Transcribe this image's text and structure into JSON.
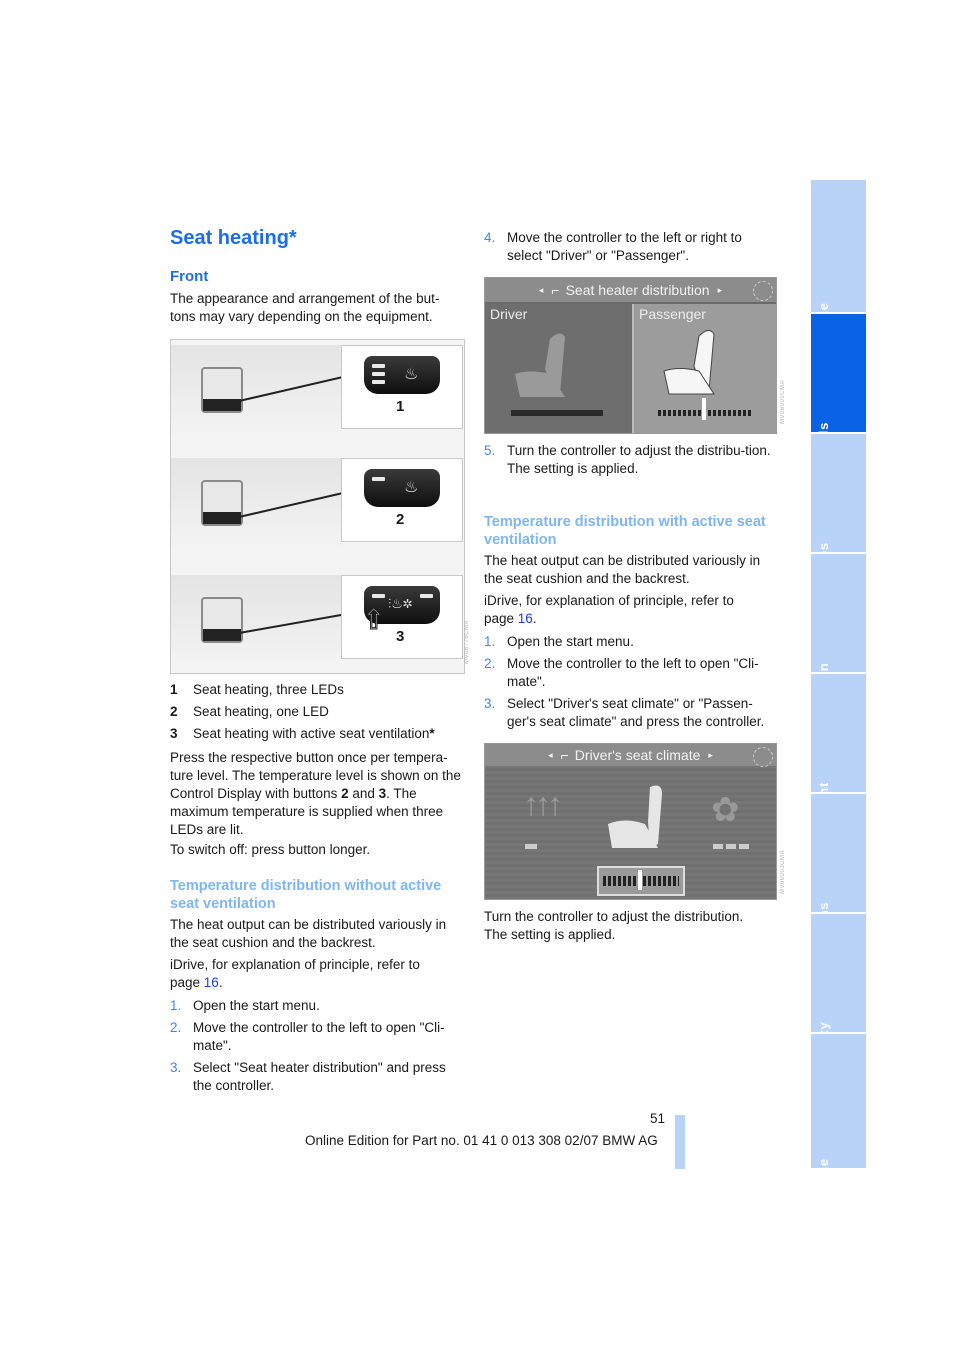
{
  "page": {
    "title": "Seat heating*",
    "page_number": "51",
    "footer": "Online Edition for Part no. 01 41 0 013 308 02/07 BMW AG"
  },
  "left_column": {
    "front_heading": "Front",
    "front_intro": "The appearance and arrangement of the but-tons may vary depending on the equipment.",
    "figure_callouts": [
      "1",
      "2",
      "3"
    ],
    "figure_code": "MV06776CMA",
    "legend": [
      {
        "num": "1",
        "text": "Seat heating, three LEDs"
      },
      {
        "num": "2",
        "text": "Seat heating, one LED"
      },
      {
        "num": "3",
        "text": "Seat heating with active seat ventilation",
        "asterisk": "*"
      }
    ],
    "press_text_1": "Press the respective button once per tempera-ture level. The temperature level is shown on the Control Display with buttons ",
    "press_bold_2": "2",
    "press_text_2": " and ",
    "press_bold_3": "3",
    "press_text_3": ". The maximum temperature is supplied when three LEDs are lit.",
    "switch_off": "To switch off: press button longer.",
    "section_without": {
      "heading": "Temperature distribution without active seat ventilation",
      "intro": "The heat output can be distributed variously in the seat cushion and the backrest.",
      "idrive_prefix": "iDrive, for explanation of principle, refer to page ",
      "idrive_link": "16",
      "idrive_suffix": ".",
      "steps": [
        {
          "num": "1.",
          "text": "Open the start menu."
        },
        {
          "num": "2.",
          "text": "Move the controller to the left to open \"Cli-mate\"."
        },
        {
          "num": "3.",
          "text": "Select \"Seat heater distribution\" and press the controller."
        }
      ]
    }
  },
  "right_column": {
    "step4": {
      "num": "4.",
      "text": "Move the controller to the left or right to select \"Driver\" or \"Passenger\"."
    },
    "screen1": {
      "header": "Seat heater distribution",
      "left_label": "Driver",
      "right_label": "Passenger",
      "selected": "Passenger"
    },
    "step5": {
      "num": "5.",
      "text": "Turn the controller to adjust the distribu-tion.",
      "sub": "The setting is applied."
    },
    "section_with": {
      "heading": "Temperature distribution with active seat ventilation",
      "intro": "The heat output can be distributed variously in the seat cushion and the backrest.",
      "idrive_prefix": "iDrive, for explanation of principle, refer to page ",
      "idrive_link": "16",
      "idrive_suffix": ".",
      "steps": [
        {
          "num": "1.",
          "text": "Open the start menu."
        },
        {
          "num": "2.",
          "text": "Move the controller to the left to open \"Cli-mate\"."
        },
        {
          "num": "3.",
          "text": "Select \"Driver's seat climate\" or \"Passen-ger's seat climate\" and press the controller."
        }
      ]
    },
    "screen2": {
      "header": "Driver's seat climate"
    },
    "closing_1": "Turn the controller to adjust the distribution.",
    "closing_2": "The setting is applied."
  },
  "side_tabs": [
    {
      "label": "At a glance",
      "active": false
    },
    {
      "label": "Controls",
      "active": true
    },
    {
      "label": "Driving tips",
      "active": false
    },
    {
      "label": "Navigation",
      "active": false
    },
    {
      "label": "Entertainment",
      "active": false
    },
    {
      "label": "Communications",
      "active": false
    },
    {
      "label": "Mobility",
      "active": false
    },
    {
      "label": "Reference",
      "active": false
    }
  ],
  "colors": {
    "accent": "#1a6fe6",
    "subheading": "#7eb6f2",
    "tab_inactive": "#b7d3f7",
    "tab_active": "#0a63e6",
    "link": "#1a3ee6"
  }
}
